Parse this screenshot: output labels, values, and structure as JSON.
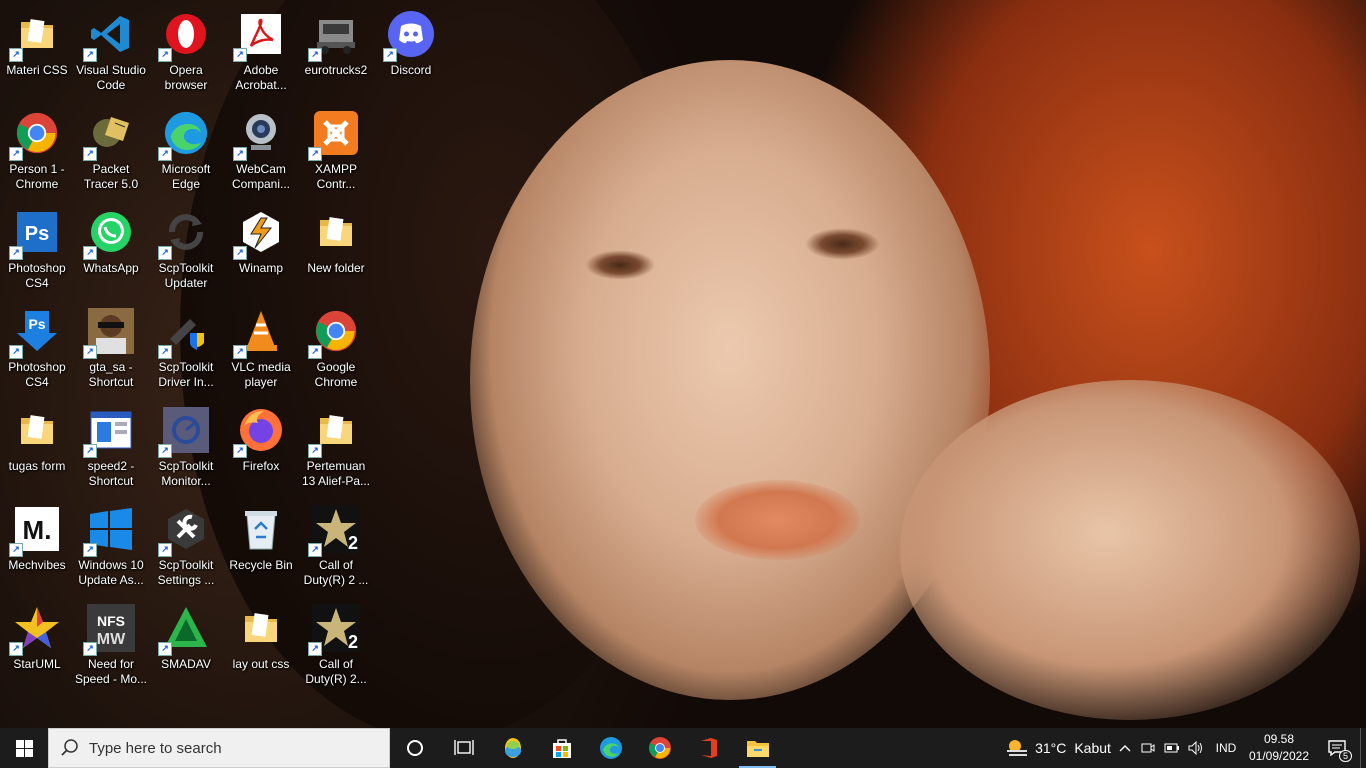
{
  "desktop": {
    "icons": [
      {
        "label": "Materi CSS",
        "icon": "folder-icon"
      },
      {
        "label": "Visual Studio Code",
        "icon": "vscode-icon"
      },
      {
        "label": "Opera browser",
        "icon": "opera-icon"
      },
      {
        "label": "Adobe Acrobat...",
        "icon": "acrobat-icon"
      },
      {
        "label": "eurotrucks2",
        "icon": "truck-icon"
      },
      {
        "label": "Discord",
        "icon": "discord-icon"
      },
      {
        "label": "Person 1 - Chrome",
        "icon": "chrome-icon"
      },
      {
        "label": "Packet Tracer 5.0",
        "icon": "packet-tracer-icon"
      },
      {
        "label": "Microsoft Edge",
        "icon": "edge-icon"
      },
      {
        "label": "WebCam Compani...",
        "icon": "webcam-icon"
      },
      {
        "label": "XAMPP Contr...",
        "icon": "xampp-icon"
      },
      {
        "label": "Photoshop CS4",
        "icon": "photoshop-icon"
      },
      {
        "label": "WhatsApp",
        "icon": "whatsapp-icon"
      },
      {
        "label": "ScpToolkit Updater",
        "icon": "refresh-icon"
      },
      {
        "label": "Winamp",
        "icon": "winamp-icon"
      },
      {
        "label": "New folder",
        "icon": "folder-icon"
      },
      {
        "label": "Photoshop CS4",
        "icon": "photoshop-installer-icon"
      },
      {
        "label": "gta_sa - Shortcut",
        "icon": "gta-icon"
      },
      {
        "label": "ScpToolkit Driver In...",
        "icon": "usb-shield-icon"
      },
      {
        "label": "VLC media player",
        "icon": "vlc-icon"
      },
      {
        "label": "Google Chrome",
        "icon": "chrome-icon"
      },
      {
        "label": "tugas form",
        "icon": "folder-icon"
      },
      {
        "label": "speed2 - Shortcut",
        "icon": "window-app-icon"
      },
      {
        "label": "ScpToolkit Monitor...",
        "icon": "monitor-icon"
      },
      {
        "label": "Firefox",
        "icon": "firefox-icon"
      },
      {
        "label": "Pertemuan 13 Alief-Pa...",
        "icon": "folder-icon"
      },
      {
        "label": "Mechvibes",
        "icon": "mechvibes-icon"
      },
      {
        "label": "Windows 10 Update As...",
        "icon": "windows-update-icon"
      },
      {
        "label": "ScpToolkit Settings ...",
        "icon": "wrench-icon"
      },
      {
        "label": "Recycle Bin",
        "icon": "recycle-bin-icon"
      },
      {
        "label": "Call of Duty(R) 2 ...",
        "icon": "cod-icon"
      },
      {
        "label": "StarUML",
        "icon": "staruml-icon"
      },
      {
        "label": "Need for Speed - Mo...",
        "icon": "nfs-icon"
      },
      {
        "label": "SMADAV",
        "icon": "smadav-icon"
      },
      {
        "label": "lay out css",
        "icon": "folder-icon"
      },
      {
        "label": "Call of Duty(R) 2...",
        "icon": "cod-icon"
      }
    ]
  },
  "taskbar": {
    "search_placeholder": "Type here to search",
    "pinned": [
      "cortana-icon",
      "task-view-icon",
      "paint-icon",
      "store-icon",
      "edge-icon",
      "chrome-icon",
      "office-icon",
      "file-explorer-icon"
    ],
    "weather": {
      "temp": "31°C",
      "condition": "Kabut"
    },
    "language": "IND",
    "time": "09.58",
    "date": "01/09/2022",
    "notification_count": "5"
  },
  "colors": {
    "taskbar_bg": "#1c1c1c",
    "active_indicator": "#7fbdf5"
  }
}
